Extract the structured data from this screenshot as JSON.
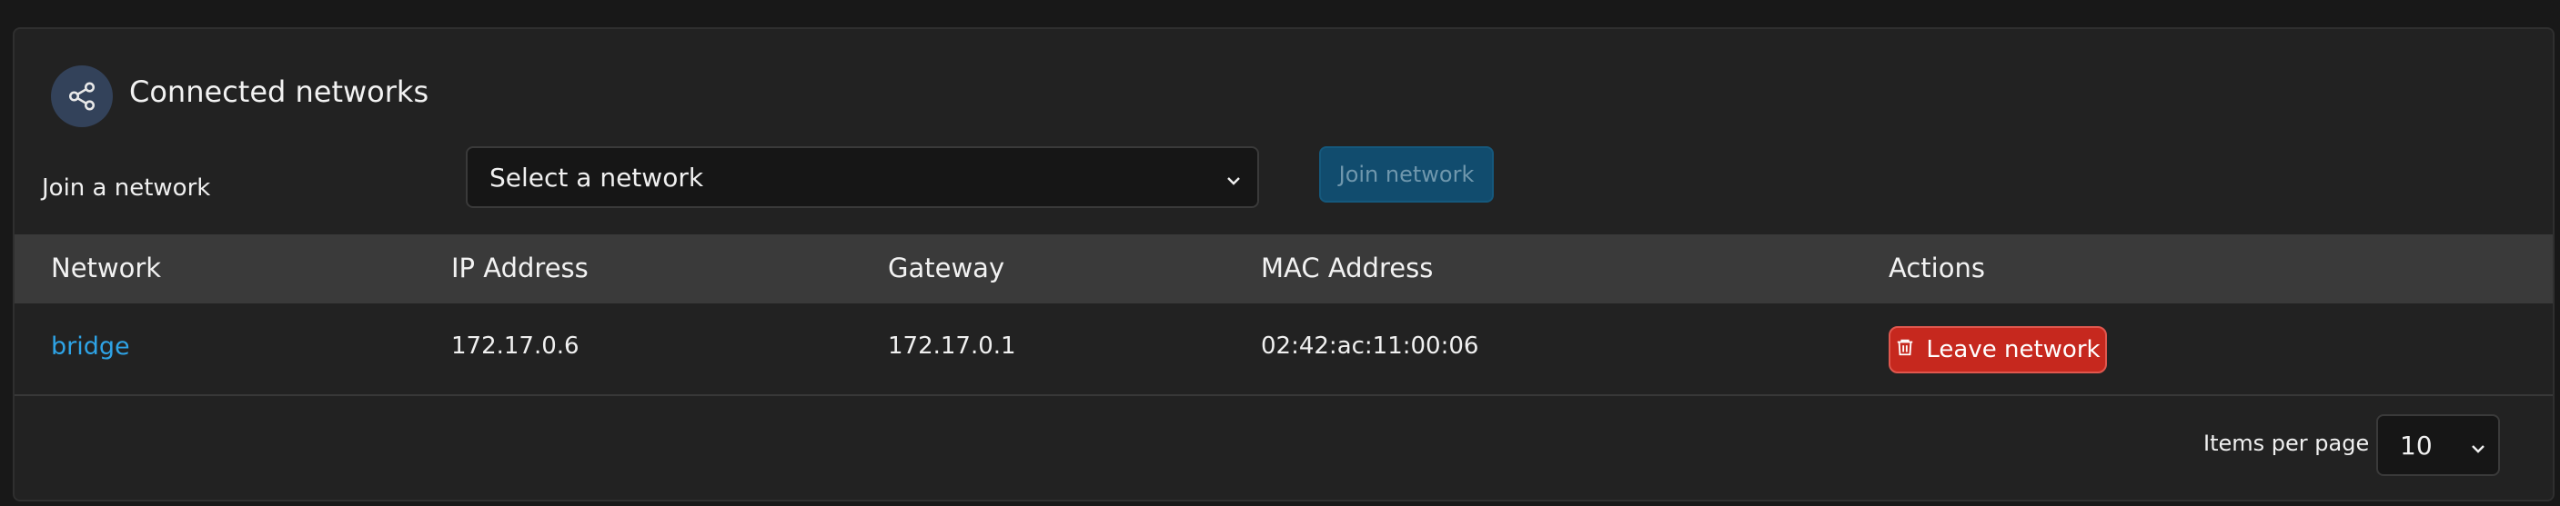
{
  "panel": {
    "title": "Connected networks",
    "icon": "share-icon"
  },
  "join": {
    "label": "Join a network",
    "select_value": "Select a network",
    "button_label": "Join network"
  },
  "table": {
    "columns": [
      "Network",
      "IP Address",
      "Gateway",
      "MAC Address",
      "Actions"
    ],
    "rows": [
      {
        "network": "bridge",
        "ip": "172.17.0.6",
        "gateway": "172.17.0.1",
        "mac": "02:42:ac:11:00:06",
        "action_label": "Leave network"
      }
    ]
  },
  "pagination": {
    "label": "Items per page",
    "value": "10"
  },
  "colors": {
    "accent_link": "#2ea3e6",
    "danger": "#c6281e",
    "primary_disabled": "#114c6e"
  }
}
